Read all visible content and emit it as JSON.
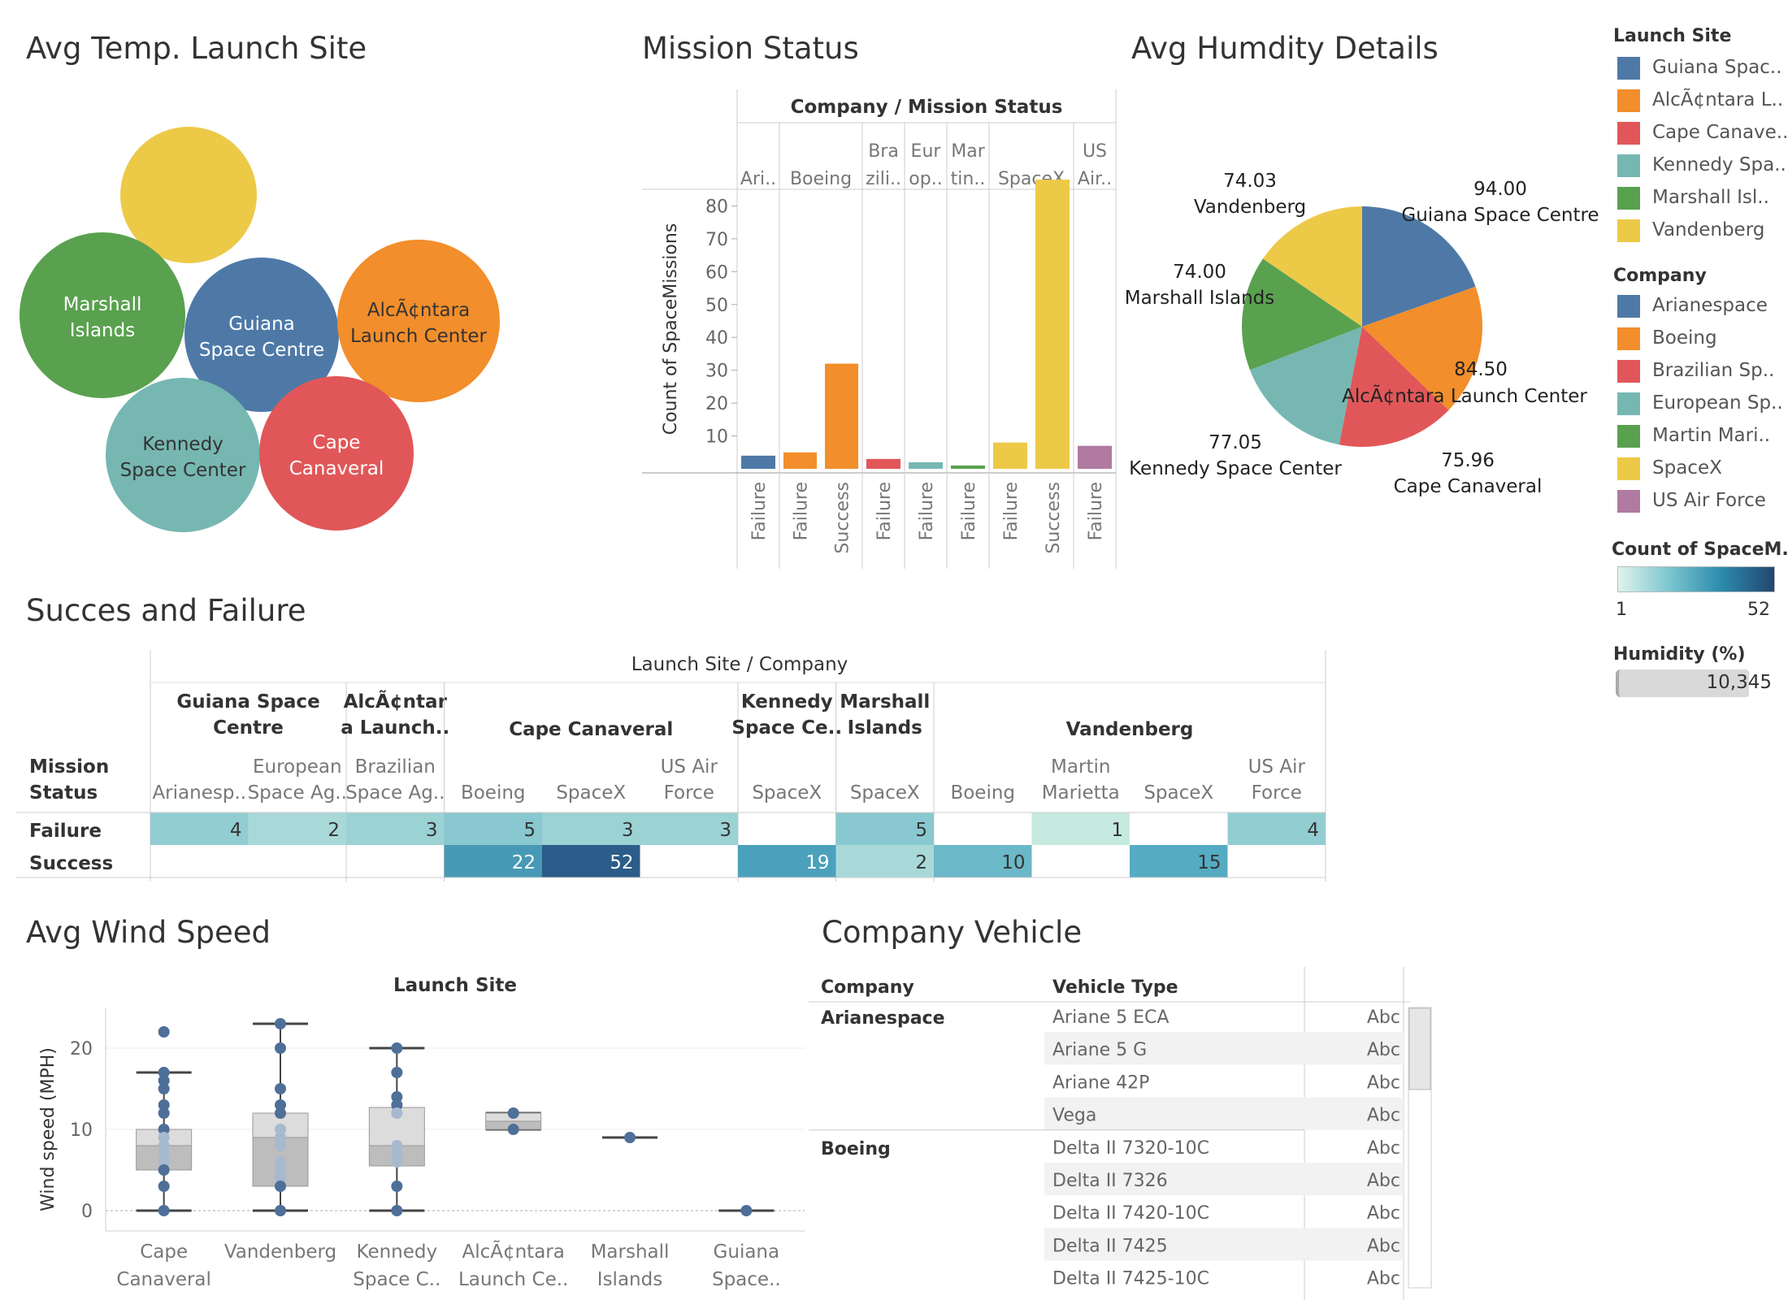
{
  "titles": {
    "bubble": "Avg Temp. Launch Site",
    "mission": "Mission Status",
    "humidity": "Avg Humdity Details",
    "success": "Succes and Failure",
    "wind": "Avg Wind Speed",
    "vehicle": "Company Vehicle"
  },
  "colors": {
    "Guiana Space Centre": "#4e79a7",
    "Alcântara Launch Center": "#f28e2b",
    "Cape Canaveral": "#e15759",
    "Kennedy Space Center": "#76b7b2",
    "Marshall Islands": "#59a14f",
    "Vandenberg": "#edc948",
    "Arianespace": "#4e79a7",
    "Boeing": "#f28e2b",
    "Brazilian Space Agency": "#e15759",
    "European Space Agency": "#76b7b2",
    "Martin Marietta": "#59a14f",
    "SpaceX": "#edc948",
    "US Air Force": "#b07aa1",
    "heat_low": "#b9e4d9",
    "heat_high": "#2b5c8a"
  },
  "legend": {
    "site_title": "Launch Site",
    "sites": [
      "Guiana Spac..",
      "AlcÃ¢ntara L..",
      "Cape Canave..",
      "Kennedy Spa..",
      "Marshall Isl..",
      "Vandenberg"
    ],
    "company_title": "Company",
    "companies": [
      "Arianespace",
      "Boeing",
      "Brazilian Sp..",
      "European Sp..",
      "Martin Mari..",
      "SpaceX",
      "US Air Force"
    ],
    "count_title": "Count of SpaceM..",
    "count_min": "1",
    "count_max": "52",
    "humidity_title": "Humidity (%)",
    "humidity_value": "10,345"
  },
  "bubbles": [
    {
      "site": "Vandenberg",
      "label": [
        "",
        ""
      ],
      "text_color": "#333"
    },
    {
      "site": "Marshall Islands",
      "label": [
        "Marshall",
        "Islands"
      ],
      "text_color": "#ffffff"
    },
    {
      "site": "Guiana Space Centre",
      "label": [
        "Guiana",
        "Space Centre"
      ],
      "text_color": "#ffffff"
    },
    {
      "site": "Alcântara Launch Center",
      "label": [
        "AlcÃ¢ntara",
        "Launch Center"
      ],
      "text_color": "#333333"
    },
    {
      "site": "Kennedy Space Center",
      "label": [
        "Kennedy",
        "Space Center"
      ],
      "text_color": "#333333"
    },
    {
      "site": "Cape Canaveral",
      "label": [
        "Cape",
        "Canaveral"
      ],
      "text_color": "#ffffff"
    }
  ],
  "mission": {
    "header": "Company  /  Mission Status",
    "ylabel": "Count of SpaceMissions",
    "yticks": [
      10,
      20,
      30,
      40,
      50,
      60,
      70,
      80
    ],
    "ymax": 90,
    "companies": [
      {
        "label": [
          "Ari.."
        ],
        "company": "Arianespace",
        "bars": [
          {
            "status": "Failure",
            "value": 4
          }
        ]
      },
      {
        "label": [
          "Boeing"
        ],
        "company": "Boeing",
        "bars": [
          {
            "status": "Failure",
            "value": 5
          },
          {
            "status": "Success",
            "value": 32
          }
        ]
      },
      {
        "label": [
          "Bra",
          "zili.."
        ],
        "company": "Brazilian Space Agency",
        "bars": [
          {
            "status": "Failure",
            "value": 3
          }
        ]
      },
      {
        "label": [
          "Eur",
          "op.."
        ],
        "company": "European Space Agency",
        "bars": [
          {
            "status": "Failure",
            "value": 2
          }
        ]
      },
      {
        "label": [
          "Mar",
          "tin.."
        ],
        "company": "Martin Marietta",
        "bars": [
          {
            "status": "Failure",
            "value": 1
          }
        ]
      },
      {
        "label": [
          "SpaceX"
        ],
        "company": "SpaceX",
        "bars": [
          {
            "status": "Failure",
            "value": 8
          },
          {
            "status": "Success",
            "value": 88
          }
        ]
      },
      {
        "label": [
          "US",
          "Air.."
        ],
        "company": "US Air Force",
        "bars": [
          {
            "status": "Failure",
            "value": 7
          }
        ]
      }
    ]
  },
  "pie": {
    "slices": [
      {
        "site": "Guiana Space Centre",
        "value": 94.0,
        "value_label": "94.00",
        "name_label": "Guiana Space Centre"
      },
      {
        "site": "Alcântara Launch Center",
        "value": 84.5,
        "value_label": "84.50",
        "name_label": "AlcÃ¢ntara Launch Center"
      },
      {
        "site": "Cape Canaveral",
        "value": 75.96,
        "value_label": "75.96",
        "name_label": "Cape Canaveral"
      },
      {
        "site": "Kennedy Space Center",
        "value": 77.05,
        "value_label": "77.05",
        "name_label": "Kennedy Space Center"
      },
      {
        "site": "Marshall Islands",
        "value": 74.0,
        "value_label": "74.00",
        "name_label": "Marshall Islands"
      },
      {
        "site": "Vandenberg",
        "value": 74.03,
        "value_label": "74.03",
        "name_label": "Vandenberg"
      }
    ]
  },
  "table": {
    "header": "Launch Site  /  Company",
    "row_header": [
      "Mission",
      "Status"
    ],
    "groups": [
      {
        "label": [
          "Guiana Space",
          "Centre"
        ],
        "span": 2
      },
      {
        "label": [
          "AlcÃ¢ntar",
          "a Launch.."
        ],
        "span": 1
      },
      {
        "label": [
          "Cape Canaveral"
        ],
        "span": 3
      },
      {
        "label": [
          "Kennedy",
          "Space Ce.."
        ],
        "span": 1
      },
      {
        "label": [
          "Marshall",
          "Islands"
        ],
        "span": 1
      },
      {
        "label": [
          "Vandenberg"
        ],
        "span": 4
      }
    ],
    "columns": [
      [
        "Arianesp.."
      ],
      [
        "European",
        "Space Ag.."
      ],
      [
        "Brazilian",
        "Space Ag.."
      ],
      [
        "Boeing"
      ],
      [
        "SpaceX"
      ],
      [
        "US Air",
        "Force"
      ],
      [
        "SpaceX"
      ],
      [
        "SpaceX"
      ],
      [
        "Boeing"
      ],
      [
        "Martin",
        "Marietta"
      ],
      [
        "SpaceX"
      ],
      [
        "US Air",
        "Force"
      ]
    ],
    "rows": [
      {
        "label": "Failure",
        "values": [
          4,
          2,
          3,
          5,
          3,
          3,
          null,
          5,
          null,
          1,
          null,
          4
        ]
      },
      {
        "label": "Success",
        "values": [
          null,
          null,
          null,
          22,
          52,
          null,
          19,
          2,
          10,
          null,
          15,
          null
        ]
      }
    ]
  },
  "wind": {
    "header": "Launch Site",
    "ylabel": "Wind speed (MPH)",
    "yticks": [
      0,
      10,
      20
    ],
    "sites": [
      {
        "label": [
          "Cape",
          "Canaveral"
        ],
        "points": [
          22,
          17,
          16,
          15,
          13,
          12,
          10,
          9,
          8,
          7,
          6,
          5,
          3,
          0
        ],
        "min": 0,
        "q1": 5,
        "median": 8,
        "q3": 10,
        "max": 17
      },
      {
        "label": [
          "Vandenberg"
        ],
        "points": [
          23,
          20,
          15,
          13,
          12,
          10,
          9,
          8,
          6,
          5,
          4,
          3,
          0
        ],
        "min": 0,
        "q1": 3,
        "median": 9,
        "q3": 12,
        "max": 23
      },
      {
        "label": [
          "Kennedy",
          "Space C.."
        ],
        "points": [
          20,
          17,
          14,
          13,
          12,
          8,
          7,
          6,
          3,
          0
        ],
        "min": 0,
        "q1": 5.5,
        "median": 8,
        "q3": 12.7,
        "max": 20
      },
      {
        "label": [
          "AlcÃ¢ntara",
          "Launch Ce.."
        ],
        "points": [
          12,
          10
        ],
        "min": 10,
        "q1": 10,
        "median": 11,
        "q3": 12,
        "max": 12
      },
      {
        "label": [
          "Marshall",
          "Islands"
        ],
        "points": [
          9
        ],
        "min": 9,
        "q1": 9,
        "median": 9,
        "q3": 9,
        "max": 9
      },
      {
        "label": [
          "Guiana",
          "Space.."
        ],
        "points": [
          0
        ],
        "min": 0,
        "q1": 0,
        "median": 0,
        "q3": 0,
        "max": 0
      }
    ]
  },
  "vehicle": {
    "headers": [
      "Company",
      "Vehicle Type"
    ],
    "groups": [
      {
        "company": "Arianespace",
        "vehicles": [
          "Ariane 5 ECA",
          "Ariane 5 G",
          "Ariane 42P",
          "Vega"
        ]
      },
      {
        "company": "Boeing",
        "vehicles": [
          "Delta II 7320-10C",
          "Delta II 7326",
          "Delta II 7420-10C",
          "Delta II 7425",
          "Delta II 7425-10C"
        ]
      }
    ],
    "cell_text": "Abc"
  }
}
